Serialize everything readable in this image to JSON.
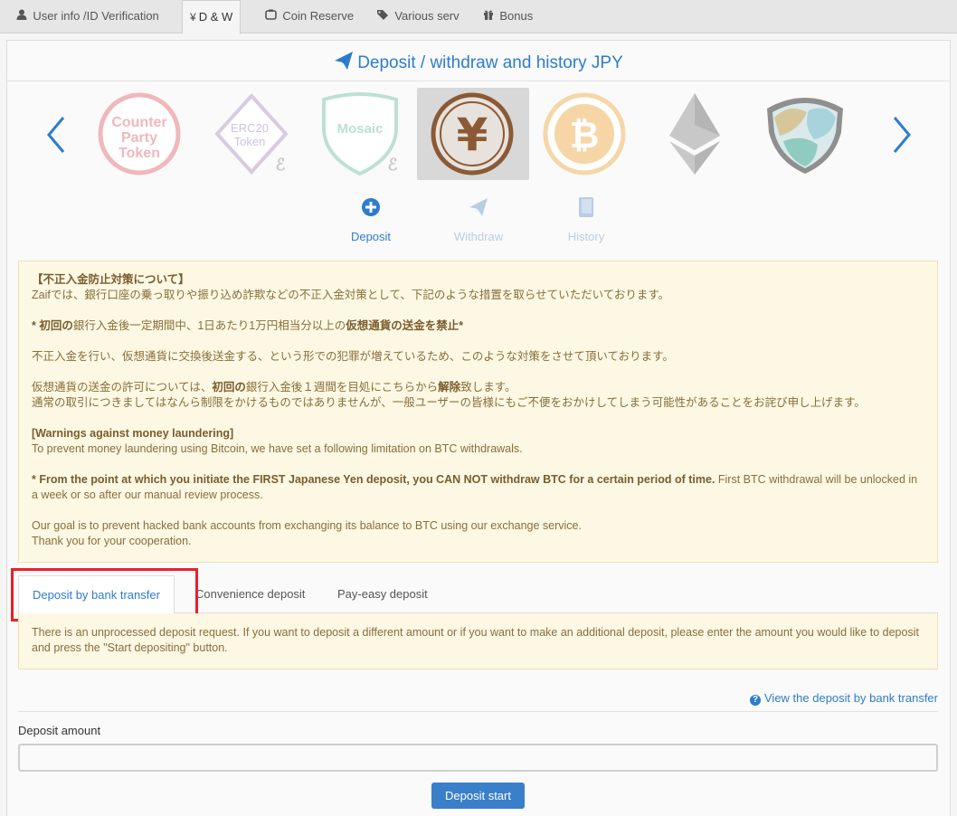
{
  "top_tabs": [
    {
      "label": "User info /ID Verification",
      "icon": "user-icon",
      "active": false
    },
    {
      "label": "D & W",
      "icon": "yen-icon",
      "active": true
    },
    {
      "label": "Coin Reserve",
      "icon": "piggy-bank-icon",
      "active": false
    },
    {
      "label": "Various serv",
      "icon": "tags-icon",
      "active": false
    },
    {
      "label": "Bonus",
      "icon": "gift-icon",
      "active": false
    }
  ],
  "page_title": "Deposit / withdraw and history JPY",
  "carousel": {
    "prev_icon": "chevron-left-icon",
    "next_icon": "chevron-right-icon",
    "coins": [
      {
        "name": "Counter Party Token",
        "line1": "Counter",
        "line2": "Party",
        "line3": "Token"
      },
      {
        "name": "ERC20 Token",
        "line1": "ERC20",
        "line2": "Token"
      },
      {
        "name": "Mosaic",
        "line1": "Mosaic"
      },
      {
        "name": "JPY",
        "symbol": "¥",
        "selected": true
      },
      {
        "name": "Bitcoin",
        "symbol": "₿"
      },
      {
        "name": "Ethereum"
      },
      {
        "name": "XEM"
      }
    ],
    "accent_color": "#2d7ccd"
  },
  "actions": [
    {
      "label": "Deposit",
      "icon": "plus-circle-icon",
      "active": true
    },
    {
      "label": "Withdraw",
      "icon": "paper-plane-icon",
      "active": false
    },
    {
      "label": "History",
      "icon": "book-icon",
      "active": false
    }
  ],
  "warning": {
    "jp_heading": "【不正入金防止対策について】",
    "jp_line1": "Zaifでは、銀行口座の乗っ取りや振り込め詐欺などの不正入金対策として、下記のような措置を取らせていただいております。",
    "jp_line2_prefix": "* 初回の",
    "jp_line2_mid": "銀行入金後一定期間中、1日あたり1万円相当分以上の",
    "jp_line2_bold": "仮想通貨の送金を禁止",
    "jp_line2_suffix": "*",
    "jp_line3": "不正入金を行い、仮想通貨に交換後送金する、という形での犯罪が増えているため、このような対策をさせて頂いております。",
    "jp_line4_prefix": "仮想通貨の送金の許可については、",
    "jp_line4_bold1": "初回の",
    "jp_line4_mid": "銀行入金後１週間を目処にこちらから",
    "jp_line4_bold2": "解除",
    "jp_line4_suffix": "致します。",
    "jp_line5": "通常の取引につきましてはなんら制限をかけるものではありませんが、一般ユーザーの皆様にもご不便をおかけしてしまう可能性があることをお詫び申し上げます。",
    "en_heading": "[Warnings against money laundering]",
    "en_line1": "To prevent money laundering using Bitcoin, we have set a following limitation on BTC withdrawals.",
    "en_bold": "* From the point at which you initiate the FIRST Japanese Yen deposit, you CAN NOT withdraw BTC for a certain period of time.",
    "en_after_bold": " First BTC withdrawal will be unlocked in a week or so after our manual review process.",
    "en_line3": "Our goal is to prevent hacked bank accounts from exchanging its balance to BTC using our exchange service.",
    "en_line4": "Thank you for your cooperation."
  },
  "deposit_tabs": [
    {
      "label": "Deposit by bank transfer",
      "active": true
    },
    {
      "label": "Convenience deposit",
      "active": false
    },
    {
      "label": "Pay-easy deposit",
      "active": false
    }
  ],
  "notice": "There is an unprocessed deposit request. If you want to deposit a different amount or if you want to make an additional deposit, please enter the amount you would like to deposit and press the \"Start depositing\" button.",
  "view_link": "View the deposit by bank transfer",
  "deposit_amount": {
    "label": "Deposit amount",
    "value": "",
    "placeholder": ""
  },
  "start_button": "Deposit start",
  "highlight_color": "#e8202a"
}
